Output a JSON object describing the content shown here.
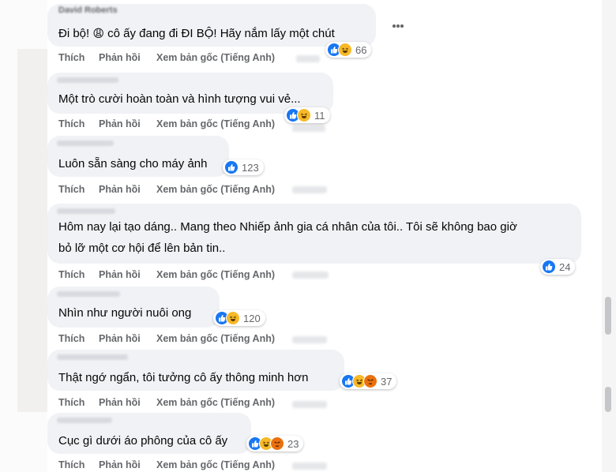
{
  "comments": [
    {
      "author": "David Roberts",
      "text": "Đi bộ! 😩 cô ấy đang đi ĐI BỘ! Hãy nắm lấy một chút",
      "text_before_emoji": "Đi bộ!",
      "text_after_emoji": "cô ấy đang đi ĐI BỘ! Hãy nắm lấy một chút",
      "actions": {
        "like": "Thích",
        "reply": "Phản hồi",
        "translate": "Xem bản gốc (Tiếng Anh)"
      },
      "reactions": [
        "like",
        "haha"
      ],
      "reaction_count": "66"
    },
    {
      "author": "",
      "text": "Một trò cười hoàn toàn và hình tượng vui vẻ...",
      "actions": {
        "like": "Thích",
        "reply": "Phản hồi",
        "translate": "Xem bản gốc (Tiếng Anh)"
      },
      "reactions": [
        "like",
        "haha"
      ],
      "reaction_count": "11"
    },
    {
      "author": "",
      "text": "Luôn sẵn sàng cho máy ảnh",
      "actions": {
        "like": "Thích",
        "reply": "Phản hồi",
        "translate": "Xem bản gốc (Tiếng Anh)"
      },
      "reactions": [
        "like"
      ],
      "reaction_count": "123"
    },
    {
      "author": "",
      "text_line1": "Hôm nay lại tạo dáng.. Mang theo Nhiếp ảnh gia cá nhân của tôi.. Tôi sẽ không bao giờ",
      "text_line2": "bỏ lỡ một cơ hội để lên bản tin..",
      "actions": {
        "like": "Thích",
        "reply": "Phản hồi",
        "translate": "Xem bản gốc (Tiếng Anh)"
      },
      "reactions": [
        "like"
      ],
      "reaction_count": "24"
    },
    {
      "author": "",
      "text": "Nhìn như người nuôi ong",
      "actions": {
        "like": "Thích",
        "reply": "Phản hồi",
        "translate": "Xem bản gốc (Tiếng Anh)"
      },
      "reactions": [
        "like",
        "haha"
      ],
      "reaction_count": "120"
    },
    {
      "author": "",
      "text": "Thật ngớ ngẩn, tôi tưởng cô ấy thông minh hơn",
      "actions": {
        "like": "Thích",
        "reply": "Phản hồi",
        "translate": "Xem bản gốc (Tiếng Anh)"
      },
      "reactions": [
        "like",
        "haha",
        "angry"
      ],
      "reaction_count": "37"
    },
    {
      "author": "",
      "text": "Cục gì dưới áo phông của cô ấy",
      "actions": {
        "like": "Thích",
        "reply": "Phản hồi",
        "translate": "Xem bản gốc (Tiếng Anh)"
      },
      "reactions": [
        "like",
        "haha",
        "angry"
      ],
      "reaction_count": "23"
    }
  ],
  "emoji": {
    "weary": "😩"
  },
  "icons": {
    "more": "more-options-icon",
    "like": "like-reaction-icon",
    "haha": "haha-reaction-icon",
    "angry": "angry-reaction-icon"
  },
  "colors": {
    "bubble": "#f0f2f5",
    "action_text": "#65676b",
    "like_blue": "#1877f2",
    "haha_yellow": "#f7b928",
    "angry_orange": "#e9710f"
  }
}
